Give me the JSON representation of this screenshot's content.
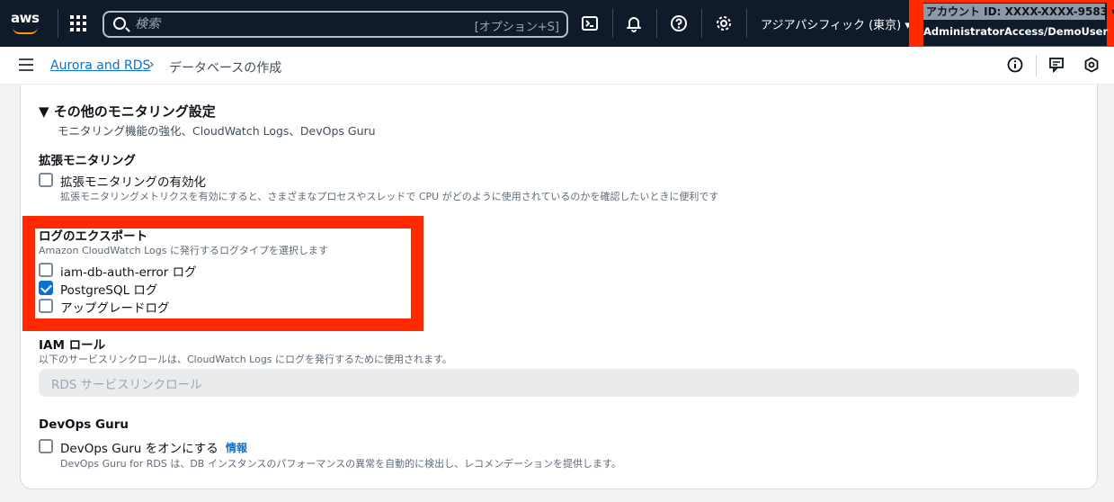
{
  "header": {
    "logo_text": "aws",
    "search": {
      "placeholder": "検索",
      "shortcut": "[オプション+S]"
    },
    "region": "アジアパシフィック (東京) ▾",
    "account_id": "アカウント ID: XXXX-XXXX-9583 ▾",
    "account_role": "AdministratorAccess/DemoUser",
    "icons": [
      "grid-icon",
      "search-icon",
      "cloudshell-icon",
      "bell-icon",
      "help-icon",
      "gear-icon"
    ]
  },
  "breadcrumb": {
    "link": "Aurora and RDS",
    "separator": "›",
    "current": "データベースの作成"
  },
  "section": {
    "title": "▼ その他のモニタリング設定",
    "subtitle": "モニタリング機能の強化、CloudWatch Logs、DevOps Guru"
  },
  "enhanced_monitoring": {
    "label": "拡張モニタリング",
    "checkbox_label": "拡張モニタリングの有効化",
    "checked": false,
    "description": "拡張モニタリングメトリクスを有効にすると、さまざまなプロセスやスレッドで CPU がどのように使用されているのかを確認したいときに便利です"
  },
  "log_export": {
    "label": "ログのエクスポート",
    "description": "Amazon CloudWatch Logs に発行するログタイプを選択します",
    "options": [
      {
        "label": "iam-db-auth-error ログ",
        "checked": false
      },
      {
        "label": "PostgreSQL ログ",
        "checked": true
      },
      {
        "label": "アップグレードログ",
        "checked": false
      }
    ]
  },
  "iam_role": {
    "label": "IAM ロール",
    "description": "以下のサービスリンクロールは、CloudWatch Logs にログを発行するために使用されます。",
    "value": "RDS サービスリンクロール"
  },
  "devops_guru": {
    "label": "DevOps Guru",
    "checkbox_label": "DevOps Guru をオンにする",
    "info_link": "情報",
    "checked": false,
    "description": "DevOps Guru for RDS は、DB インスタンスのパフォーマンスの異常を自動的に検出し、レコメンデーションを提供します。"
  },
  "colors": {
    "topbar": "#0f1b2a",
    "accent_blue": "#0972d3",
    "highlight_red": "#ff2a00"
  }
}
